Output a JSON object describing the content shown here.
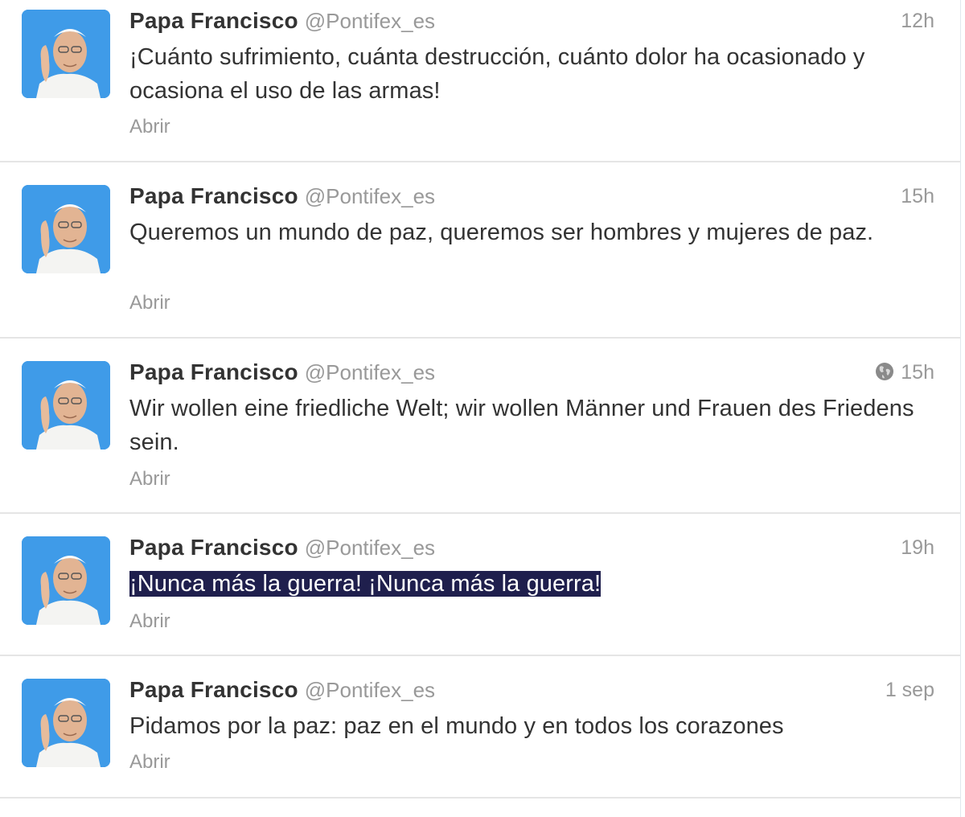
{
  "tweets": [
    {
      "fullname": "Papa Francisco",
      "username": "@Pontifex_es",
      "time": "12h",
      "text": "¡Cuánto sufrimiento, cuánta destrucción, cuánto dolor ha ocasionado y ocasiona el uso de las armas!",
      "action": "Abrir",
      "geo": false,
      "highlighted": false
    },
    {
      "fullname": "Papa Francisco",
      "username": "@Pontifex_es",
      "time": "15h",
      "text": "Queremos un mundo de paz, queremos ser hombres y mujeres de paz.",
      "action": "Abrir",
      "geo": false,
      "highlighted": false
    },
    {
      "fullname": "Papa Francisco",
      "username": "@Pontifex_es",
      "time": "15h",
      "text": "Wir wollen eine friedliche Welt; wir wollen Männer und Frauen des Friedens sein.",
      "action": "Abrir",
      "geo": true,
      "geo_icon": "globe-icon",
      "highlighted": false
    },
    {
      "fullname": "Papa Francisco",
      "username": "@Pontifex_es",
      "time": "19h",
      "text": "¡Nunca más la guerra! ¡Nunca más la guerra!",
      "action": "Abrir",
      "geo": false,
      "highlighted": true
    },
    {
      "fullname": "Papa Francisco",
      "username": "@Pontifex_es",
      "time": "1 sep",
      "text": "Pidamos por la paz: paz en el mundo y en todos los corazones",
      "action": "Abrir",
      "geo": false,
      "highlighted": false
    }
  ],
  "colors": {
    "avatar_background": "#3f9be8",
    "selection_background": "#1f1f4d",
    "name": "#333333",
    "meta": "#999999"
  }
}
